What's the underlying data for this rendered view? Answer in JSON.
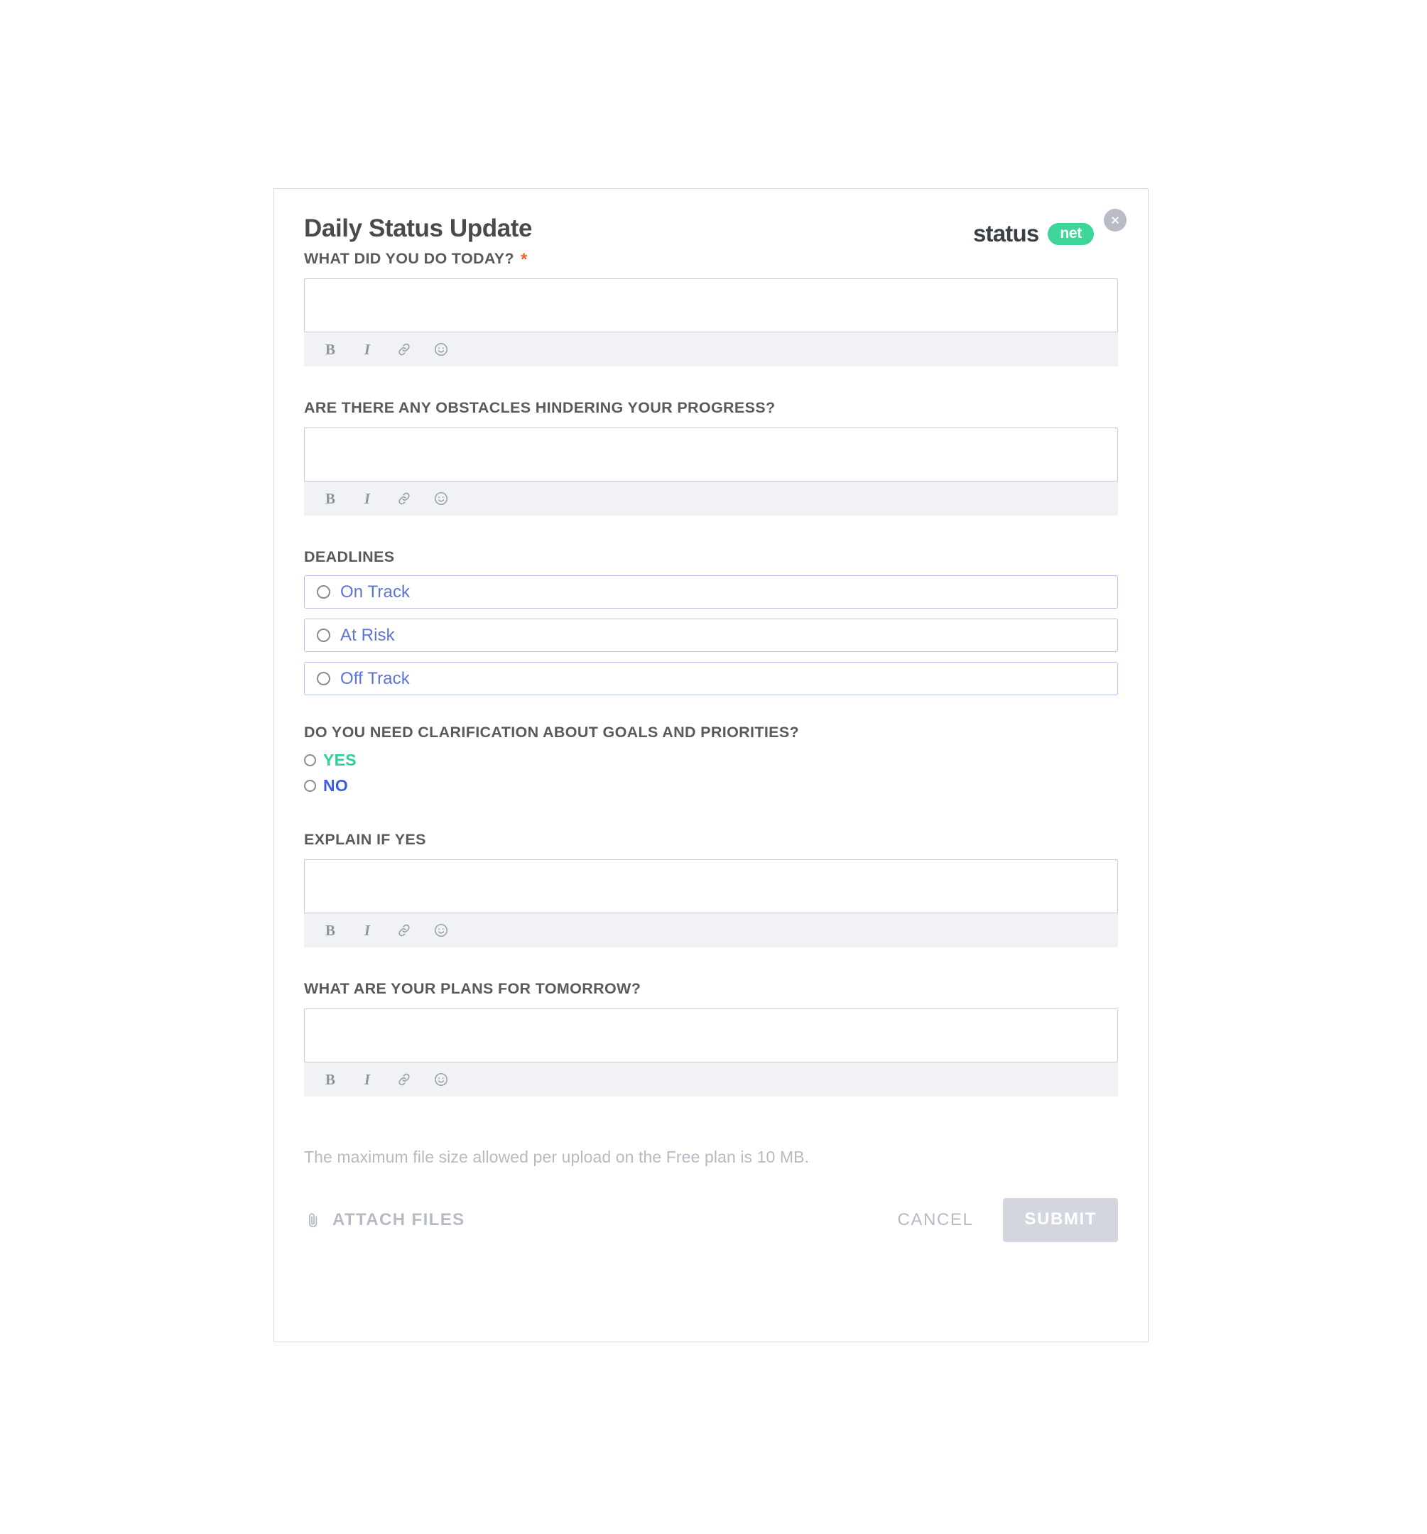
{
  "modal": {
    "title": "Daily Status Update",
    "close_icon": "close-icon",
    "brand": {
      "word": "status",
      "pill": "net"
    }
  },
  "fields": {
    "today": {
      "label": "WHAT DID YOU DO TODAY?",
      "required_marker": "*",
      "value": "",
      "placeholder": ""
    },
    "obstacles": {
      "label": "ARE THERE ANY OBSTACLES HINDERING YOUR PROGRESS?",
      "value": "",
      "placeholder": ""
    },
    "deadlines": {
      "label": "DEADLINES",
      "options": [
        {
          "label": "On Track",
          "selected": false
        },
        {
          "label": "At Risk",
          "selected": false
        },
        {
          "label": "Off Track",
          "selected": false
        }
      ]
    },
    "clarification": {
      "label": "DO YOU NEED CLARIFICATION ABOUT GOALS AND PRIORITIES?",
      "options": [
        {
          "label": "YES",
          "selected": false
        },
        {
          "label": "NO",
          "selected": false
        }
      ]
    },
    "explain": {
      "label": "EXPLAIN IF YES",
      "value": "",
      "placeholder": ""
    },
    "tomorrow": {
      "label": "WHAT ARE YOUR PLANS FOR TOMORROW?",
      "value": "",
      "placeholder": ""
    }
  },
  "toolbar": {
    "bold": "B",
    "italic": "I",
    "link_icon": "link-icon",
    "emoji_icon": "emoji-icon"
  },
  "footer": {
    "note": "The maximum file size allowed per upload on the Free plan is 10 MB.",
    "attach_label": "ATTACH FILES",
    "attach_icon": "paperclip-icon",
    "cancel_label": "CANCEL",
    "submit_label": "SUBMIT"
  },
  "colors": {
    "brand_green": "#3ed598",
    "required_orange": "#f2622a",
    "option_blue": "#5f73d6",
    "yes_green": "#2fd191",
    "no_blue": "#3a5ce8",
    "muted_gray": "#b6bac4",
    "submit_disabled": "#d3d6de"
  }
}
